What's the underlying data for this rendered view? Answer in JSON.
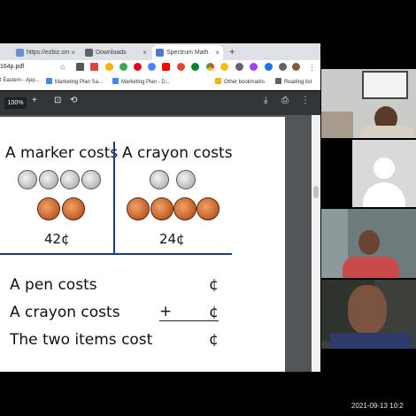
{
  "browser": {
    "tabs": [
      {
        "label": "https://ezbiz.sm"
      },
      {
        "label": "Downloads"
      },
      {
        "label": "Spectrum Math"
      }
    ],
    "url": "164p.pdf",
    "bookmarks": [
      {
        "label": "t Eastern - App..."
      },
      {
        "label": "Marketing Plan Sa..."
      },
      {
        "label": "Marketing Plan - D..."
      },
      {
        "label": "Other bookmarks"
      },
      {
        "label": "Reading list"
      }
    ]
  },
  "pdf": {
    "zoom": "100%",
    "zoom_plus": "+"
  },
  "worksheet": {
    "marker_heading": "A marker costs",
    "crayon_heading": "A crayon costs",
    "marker_price": "42¢",
    "crayon_price": "24¢",
    "marker_coins": {
      "dimes": 4,
      "pennies": 2
    },
    "crayon_coins": {
      "dimes": 2,
      "pennies": 4
    },
    "rows": [
      {
        "label": "A pen costs",
        "operator": "",
        "unit": "¢"
      },
      {
        "label": "A crayon costs",
        "operator": "+",
        "unit": "¢"
      },
      {
        "label": "The two items cost",
        "operator": "",
        "unit": "¢"
      }
    ]
  },
  "video": {
    "timestamp": "2021-09-13 10:2"
  },
  "colors": {
    "divider": "#1a3a8c",
    "pdf_toolbar": "#323639"
  }
}
